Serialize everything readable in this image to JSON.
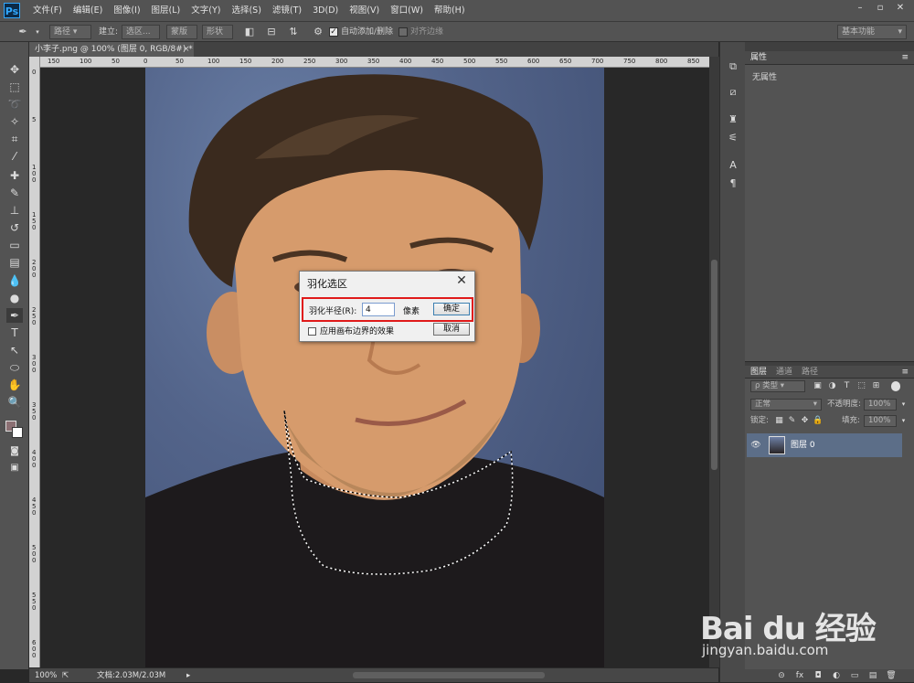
{
  "app": {
    "logo": "Ps"
  },
  "menu": [
    "文件(F)",
    "编辑(E)",
    "图像(I)",
    "图层(L)",
    "文字(Y)",
    "选择(S)",
    "滤镜(T)",
    "3D(D)",
    "视图(V)",
    "窗口(W)",
    "帮助(H)"
  ],
  "window_controls": {
    "minimize": "–",
    "restore": "▫",
    "close": "✕"
  },
  "options_bar": {
    "pen_mode": "路径",
    "make_label": "建立:",
    "selection_btn": "选区...",
    "mask_btn": "蒙版",
    "shape_btn": "形状",
    "auto_add_delete": "自动添加/删除",
    "align_edges": "对齐边缘",
    "workspace": "基本功能"
  },
  "document": {
    "tab_title": "小李子.png @ 100% (图层 0, RGB/8#) *",
    "tab_close": "×",
    "zoom": "100%",
    "doc_info": "文档:2.03M/2.03M"
  },
  "ruler": {
    "top_ticks": [
      "150",
      "100",
      "50",
      "0",
      "50",
      "100",
      "150",
      "200",
      "250",
      "300",
      "350",
      "400",
      "450",
      "500",
      "550",
      "600",
      "650",
      "700",
      "750",
      "800",
      "850"
    ],
    "left_ticks": [
      "0",
      "5",
      "1 0 0",
      "1 5 0",
      "2 0 0",
      "2 5 0",
      "3 0 0",
      "3 5 0",
      "4 0 0",
      "4 5 0",
      "5 0 0",
      "5 5 0",
      "6 0 0"
    ]
  },
  "properties_panel": {
    "tab": "属性",
    "empty_text": "无属性"
  },
  "layers_panel": {
    "tabs": [
      "图层",
      "通道",
      "路径"
    ],
    "filter_kind": "ρ 类型",
    "blend_mode": "正常",
    "opacity_label": "不透明度:",
    "opacity_value": "100%",
    "lock_label": "锁定:",
    "fill_label": "填充:",
    "fill_value": "100%",
    "layers": [
      {
        "name": "图层 0",
        "visible": true
      }
    ],
    "footer_icons": [
      "link-icon",
      "fx-icon",
      "mask-icon",
      "adjustment-icon",
      "group-icon",
      "new-layer-icon",
      "delete-icon"
    ]
  },
  "feather_dialog": {
    "title": "羽化选区",
    "radius_label": "羽化半径(R):",
    "radius_value": "4",
    "unit": "像素",
    "ok": "确定",
    "cancel": "取消",
    "apply_canvas_bounds": "应用画布边界的效果",
    "apply_canvas_bounds_checked": false,
    "close": "✕",
    "highlight_color": "#e01a1a"
  },
  "watermark": {
    "logo": "Bai du 经验",
    "url": "jingyan.baidu.com"
  },
  "colors": {
    "foreground": "#8b6f73",
    "background": "#ffffff",
    "accent": "#31a8ff"
  }
}
